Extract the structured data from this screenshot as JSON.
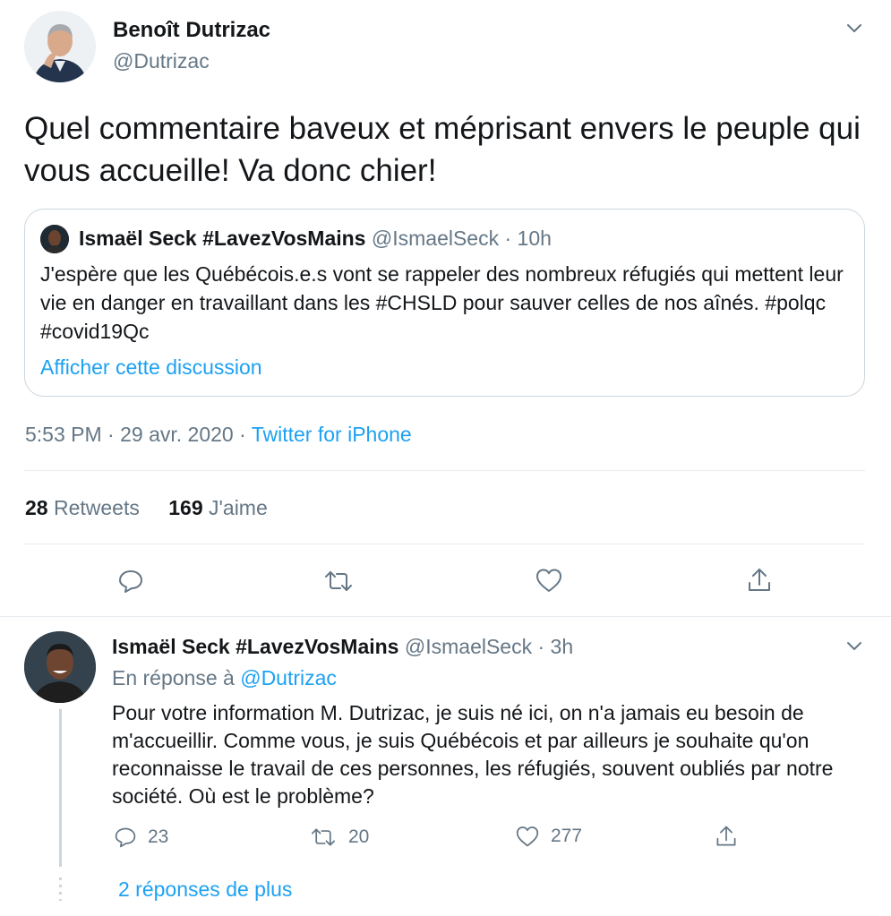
{
  "main_tweet": {
    "author_name": "Benoît Dutrizac",
    "author_handle": "@Dutrizac",
    "text": "Quel commentaire baveux et méprisant envers le peuple qui vous accueille! Va donc chier!",
    "timestamp": "5:53 PM · 29 avr. 2020 · ",
    "client": "Twitter for iPhone",
    "retweets_count": "28",
    "retweets_label": " Retweets",
    "likes_count": "169",
    "likes_label": " J'aime"
  },
  "quoted_tweet": {
    "author_name": "Ismaël Seck #LavezVosMains",
    "meta": " @IsmaelSeck · 10h",
    "text": "J'espère que les Québécois.e.s vont se rappeler des nombreux réfugiés qui mettent leur vie en danger en travaillant dans les #CHSLD pour sauver celles de nos aînés. #polqc #covid19Qc",
    "show_thread_label": "Afficher cette discussion"
  },
  "reply": {
    "author_name": "Ismaël Seck #LavezVosMains",
    "meta": " @IsmaelSeck · 3h",
    "reply_prefix": "En réponse à ",
    "reply_to": "@Dutrizac",
    "text": "Pour votre information M. Dutrizac, je suis né ici, on n'a jamais eu besoin de m'accueillir. Comme vous, je suis Québécois et par ailleurs je souhaite qu'on reconnaisse le travail de ces personnes, les réfugiés, souvent oubliés par notre société. Où est le problème?",
    "replies_count": "23",
    "retweets_count": "20",
    "likes_count": "277",
    "more_replies_label": "2 réponses de plus"
  },
  "icons": {
    "menu": "chevron-down-icon",
    "reply": "speech-bubble-icon",
    "retweet": "retweet-arrows-icon",
    "like": "heart-icon",
    "share": "share-upload-icon"
  },
  "colors": {
    "link": "#1da1f2",
    "secondary_text": "#657786",
    "border": "#ccd6dd"
  }
}
